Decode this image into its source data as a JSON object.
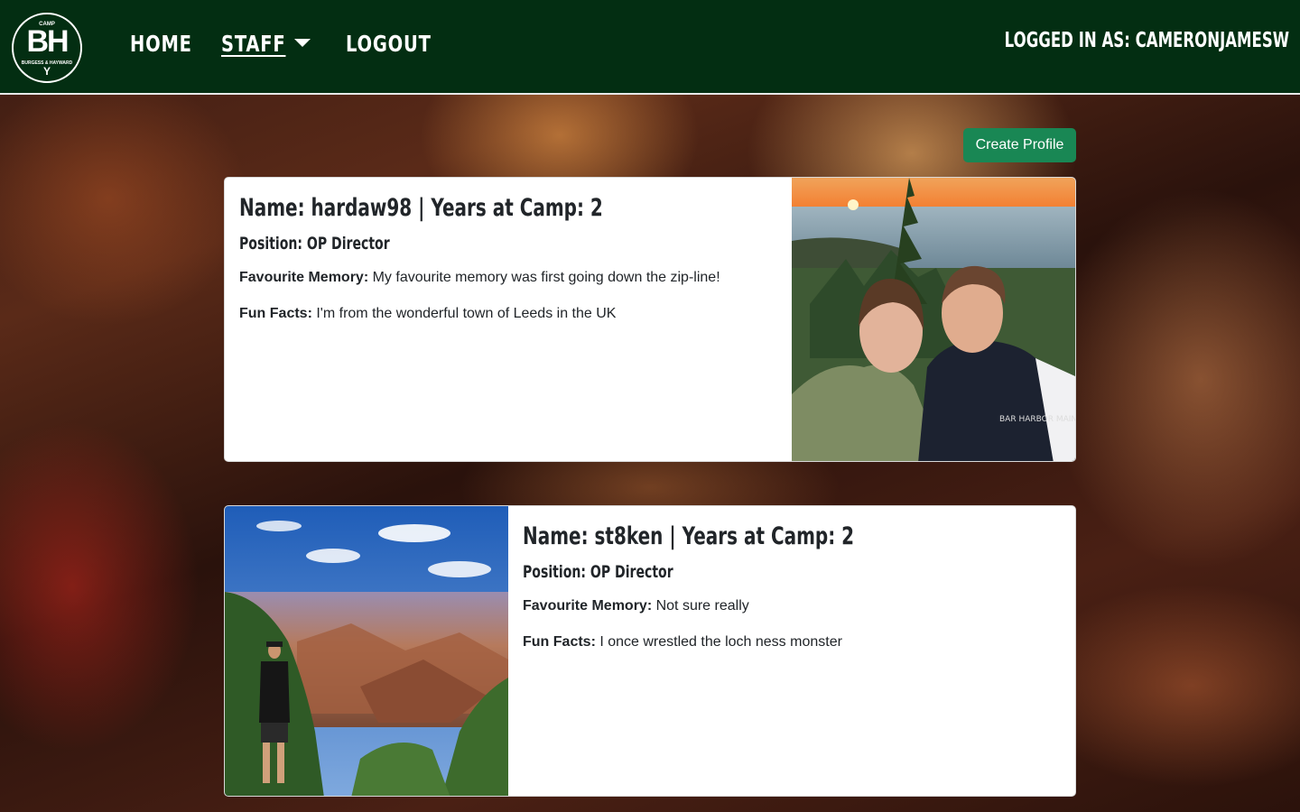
{
  "brand": {
    "logo_top": "CAMP",
    "logo_main": "BH",
    "logo_sub": "BURGESS & HAYWARD",
    "logo_mark": "Y"
  },
  "nav": {
    "home": "HOME",
    "staff": "STAFF",
    "logout": "LOGOUT",
    "logged_in": "LOGGED IN AS: CAMERONJAMESW"
  },
  "actions": {
    "create_profile": "Create Profile"
  },
  "labels": {
    "favourite_memory": "Favourite Memory:",
    "fun_facts": "Fun Facts:"
  },
  "profiles": [
    {
      "title": "Name: hardaw98 | Years at Camp: 2",
      "position": "Position: OP Director",
      "favourite_memory": "My favourite memory was first going down the zip-line!",
      "fun_facts": "I'm from the wonderful town of Leeds in the UK",
      "hoodie_text": "BAR HARBOR MAINE"
    },
    {
      "title": "Name: st8ken | Years at Camp: 2",
      "position": "Position: OP Director",
      "favourite_memory": "Not sure really",
      "fun_facts": "I once wrestled the loch ness monster"
    }
  ],
  "colors": {
    "nav_bg": "#032e12",
    "button_green": "#198754"
  }
}
